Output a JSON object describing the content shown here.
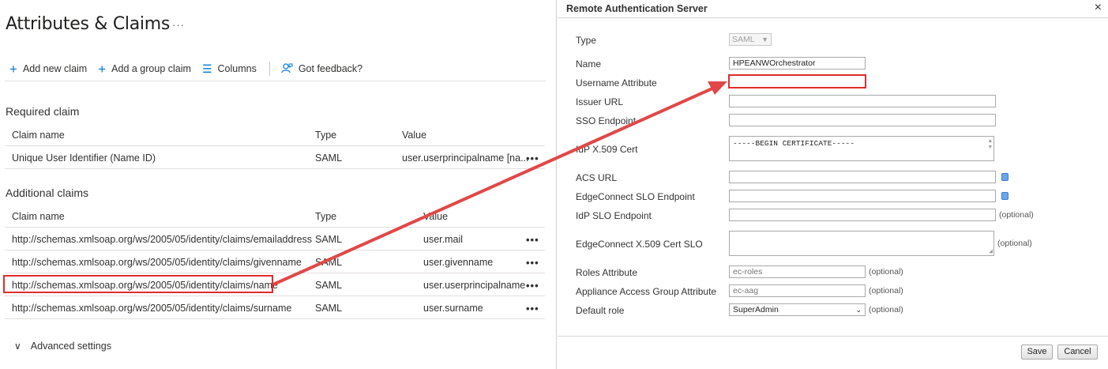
{
  "left": {
    "title": "Attributes & Claims",
    "title_more": "···",
    "toolbar": {
      "add_new_claim": "Add new claim",
      "add_group_claim": "Add a group claim",
      "columns": "Columns",
      "feedback": "Got feedback?"
    },
    "required": {
      "heading": "Required claim",
      "columns": [
        "Claim name",
        "Type",
        "Value"
      ],
      "rows": [
        {
          "name": "Unique User Identifier (Name ID)",
          "type": "SAML",
          "value": "user.userprincipalname [na..."
        }
      ]
    },
    "additional": {
      "heading": "Additional claims",
      "columns": [
        "Claim name",
        "Type",
        "Value"
      ],
      "rows": [
        {
          "name": "http://schemas.xmlsoap.org/ws/2005/05/identity/claims/emailaddress",
          "type": "SAML",
          "value": "user.mail"
        },
        {
          "name": "http://schemas.xmlsoap.org/ws/2005/05/identity/claims/givenname",
          "type": "SAML",
          "value": "user.givenname"
        },
        {
          "name": "http://schemas.xmlsoap.org/ws/2005/05/identity/claims/name",
          "type": "SAML",
          "value": "user.userprincipalname"
        },
        {
          "name": "http://schemas.xmlsoap.org/ws/2005/05/identity/claims/surname",
          "type": "SAML",
          "value": "user.surname"
        }
      ]
    },
    "advanced_settings": "Advanced settings",
    "row_more": "•••"
  },
  "dialog": {
    "title": "Remote Authentication Server",
    "close": "×",
    "fields": {
      "type_label": "Type",
      "type_value": "SAML",
      "name_label": "Name",
      "name_value": "HPEANWOrchestrator",
      "username_attr_label": "Username Attribute",
      "username_attr_value": "",
      "issuer_url_label": "Issuer URL",
      "sso_endpoint_label": "SSO Endpoint",
      "idp_cert_label": "IdP X.509 Cert",
      "idp_cert_value": "-----BEGIN CERTIFICATE-----",
      "acs_url_label": "ACS URL",
      "ec_slo_endpoint_label": "EdgeConnect SLO Endpoint",
      "idp_slo_endpoint_label": "IdP SLO Endpoint",
      "ec_cert_slo_label": "EdgeConnect X.509 Cert SLO",
      "roles_attr_label": "Roles Attribute",
      "roles_attr_placeholder": "ec-roles",
      "aag_attr_label": "Appliance Access Group Attribute",
      "aag_attr_placeholder": "ec-aag",
      "default_role_label": "Default role",
      "default_role_value": "SuperAdmin",
      "optional": "(optional)"
    },
    "buttons": {
      "save": "Save",
      "cancel": "Cancel"
    }
  },
  "colors": {
    "accent": "#0078d4",
    "highlight": "#e02c2c"
  }
}
